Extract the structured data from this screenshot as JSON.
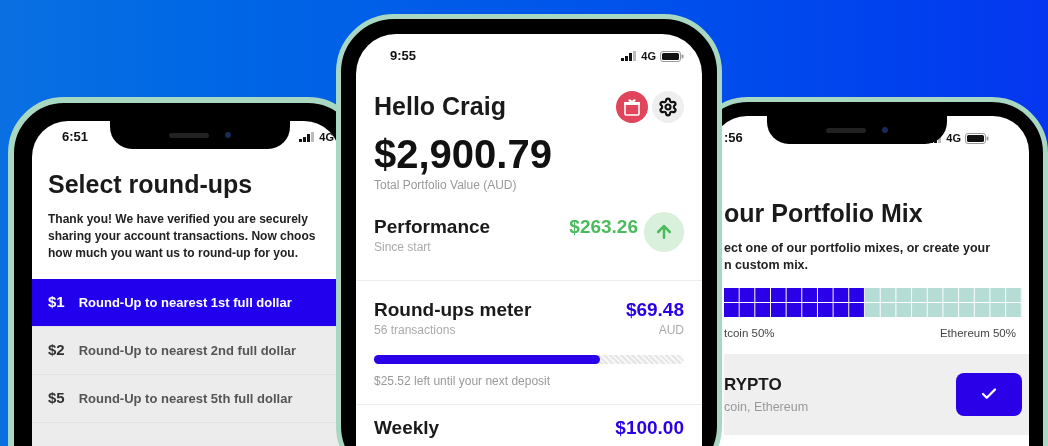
{
  "left_phone": {
    "status": {
      "time": "6:51",
      "network": "4G"
    },
    "title": "Select round-ups",
    "intro_lines": [
      "Thank you! We have verified you are securely",
      "sharing your account transactions. Now choos",
      "how much you want us to round-up for you."
    ],
    "options": [
      {
        "amount": "$1",
        "label": "Round-Up to nearest 1st full dollar",
        "selected": true
      },
      {
        "amount": "$2",
        "label": "Round-Up to nearest 2nd full dollar",
        "selected": false
      },
      {
        "amount": "$5",
        "label": "Round-Up to nearest 5th full dollar",
        "selected": false
      }
    ]
  },
  "center_phone": {
    "status": {
      "time": "9:55",
      "network": "4G"
    },
    "greeting": "Hello Craig",
    "total": {
      "value": "$2,900.79",
      "label": "Total Portfolio Value (AUD)"
    },
    "performance": {
      "title": "Performance",
      "subtitle": "Since start",
      "value": "$263.26",
      "kind": "up"
    },
    "roundups_meter": {
      "title": "Round-ups meter",
      "subtitle": "56 transactions",
      "value": "$69.48",
      "currency": "AUD",
      "level": 0.73,
      "note": "$25.52 left until your next deposit"
    },
    "weekly": {
      "title": "Weekly",
      "value": "$100.00"
    }
  },
  "right_phone": {
    "status": {
      "time": ":56",
      "network": "4G"
    },
    "title": "our Portfolio Mix",
    "intro_lines": [
      "ect one of our portfolio mixes, or create your",
      "n custom mix."
    ],
    "mix": {
      "level": 0.47,
      "left_label": "tcoin 50%",
      "right_label": "Ethereum 50%"
    },
    "portfolio": {
      "name": "RYPTO",
      "assets": "coin, Ethereum",
      "selected": true
    }
  }
}
